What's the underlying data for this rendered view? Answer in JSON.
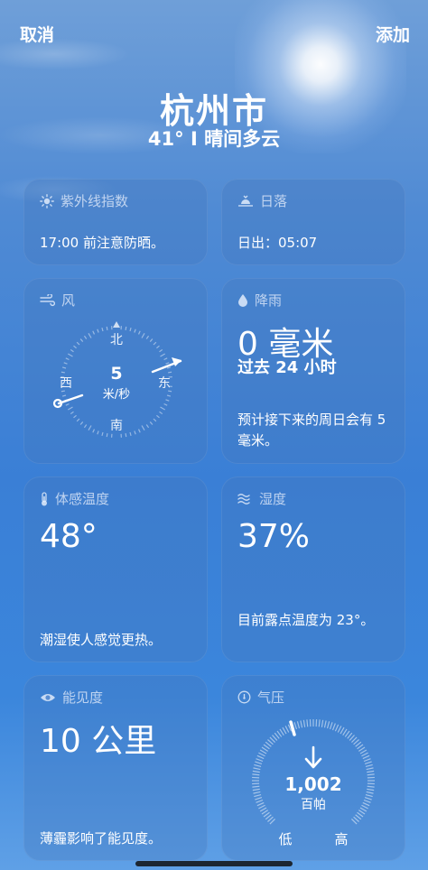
{
  "header": {
    "cancel_label": "取消",
    "add_label": "添加",
    "city": "杭州市",
    "condition": "41° I 晴间多云"
  },
  "uv": {
    "title": "紫外线指数",
    "text": "17:00 前注意防晒。",
    "icon": "sun-icon"
  },
  "sunset": {
    "title": "日落",
    "text": "日出：05:07",
    "icon": "sunset-icon"
  },
  "wind": {
    "title": "风",
    "icon": "wind-icon",
    "north": "北",
    "south": "南",
    "east": "东",
    "west": "西",
    "speed": "5",
    "unit": "米/秒"
  },
  "rain": {
    "title": "降雨",
    "icon": "raindrop-icon",
    "amount": "0 毫米",
    "period": "过去 24 小时",
    "forecast": "预计接下来的周日会有 5 毫米。"
  },
  "feels": {
    "title": "体感温度",
    "icon": "thermometer-icon",
    "value": "48°",
    "text": "潮湿使人感觉更热。"
  },
  "humidity": {
    "title": "湿度",
    "icon": "humidity-icon",
    "value": "37%",
    "text": "目前露点温度为 23°。"
  },
  "visibility": {
    "title": "能见度",
    "icon": "eye-icon",
    "value": "10 公里",
    "text": "薄霾影响了能见度。"
  },
  "pressure": {
    "title": "气压",
    "icon": "gauge-icon",
    "value": "1,002",
    "unit": "百帕",
    "low": "低",
    "high": "高",
    "trend_icon": "arrow-down-icon"
  }
}
